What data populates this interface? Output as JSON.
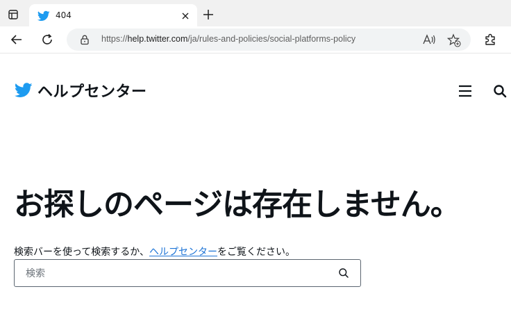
{
  "browser": {
    "tab": {
      "title": "404"
    },
    "address": {
      "scheme": "https://",
      "host": "help.twitter.com",
      "path": "/ja/rules-and-policies/social-platforms-policy"
    }
  },
  "site": {
    "brand": "ヘルプセンター",
    "accent_color": "#1d9bf0",
    "link_color": "#1d74d6"
  },
  "error": {
    "headline": "お探しのページは存在しません。",
    "hint_before": "検索バーを使って検索するか、",
    "hint_link": "ヘルプセンター",
    "hint_after": "をご覧ください。"
  },
  "search": {
    "placeholder": "検索",
    "value": ""
  }
}
